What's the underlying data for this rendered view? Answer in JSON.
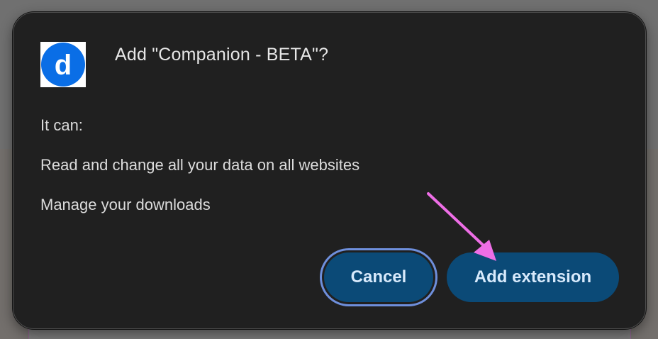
{
  "dialog": {
    "title": "Add \"Companion - BETA\"?",
    "logo_letter": "d",
    "intro": "It can:",
    "permissions": [
      "Read and change all your data on all websites",
      "Manage your downloads"
    ],
    "buttons": {
      "cancel": "Cancel",
      "add": "Add extension"
    }
  },
  "colors": {
    "dialog_bg": "#202020",
    "button_bg": "#0b4a77",
    "button_text": "#d7e9fb",
    "focus_ring": "#6e8fdc",
    "logo_blue": "#0a6ee6",
    "annotation_arrow": "#ee6ee6"
  },
  "icons": {
    "logo": "companion-d-logo",
    "annotation": "pointer-arrow-icon"
  }
}
